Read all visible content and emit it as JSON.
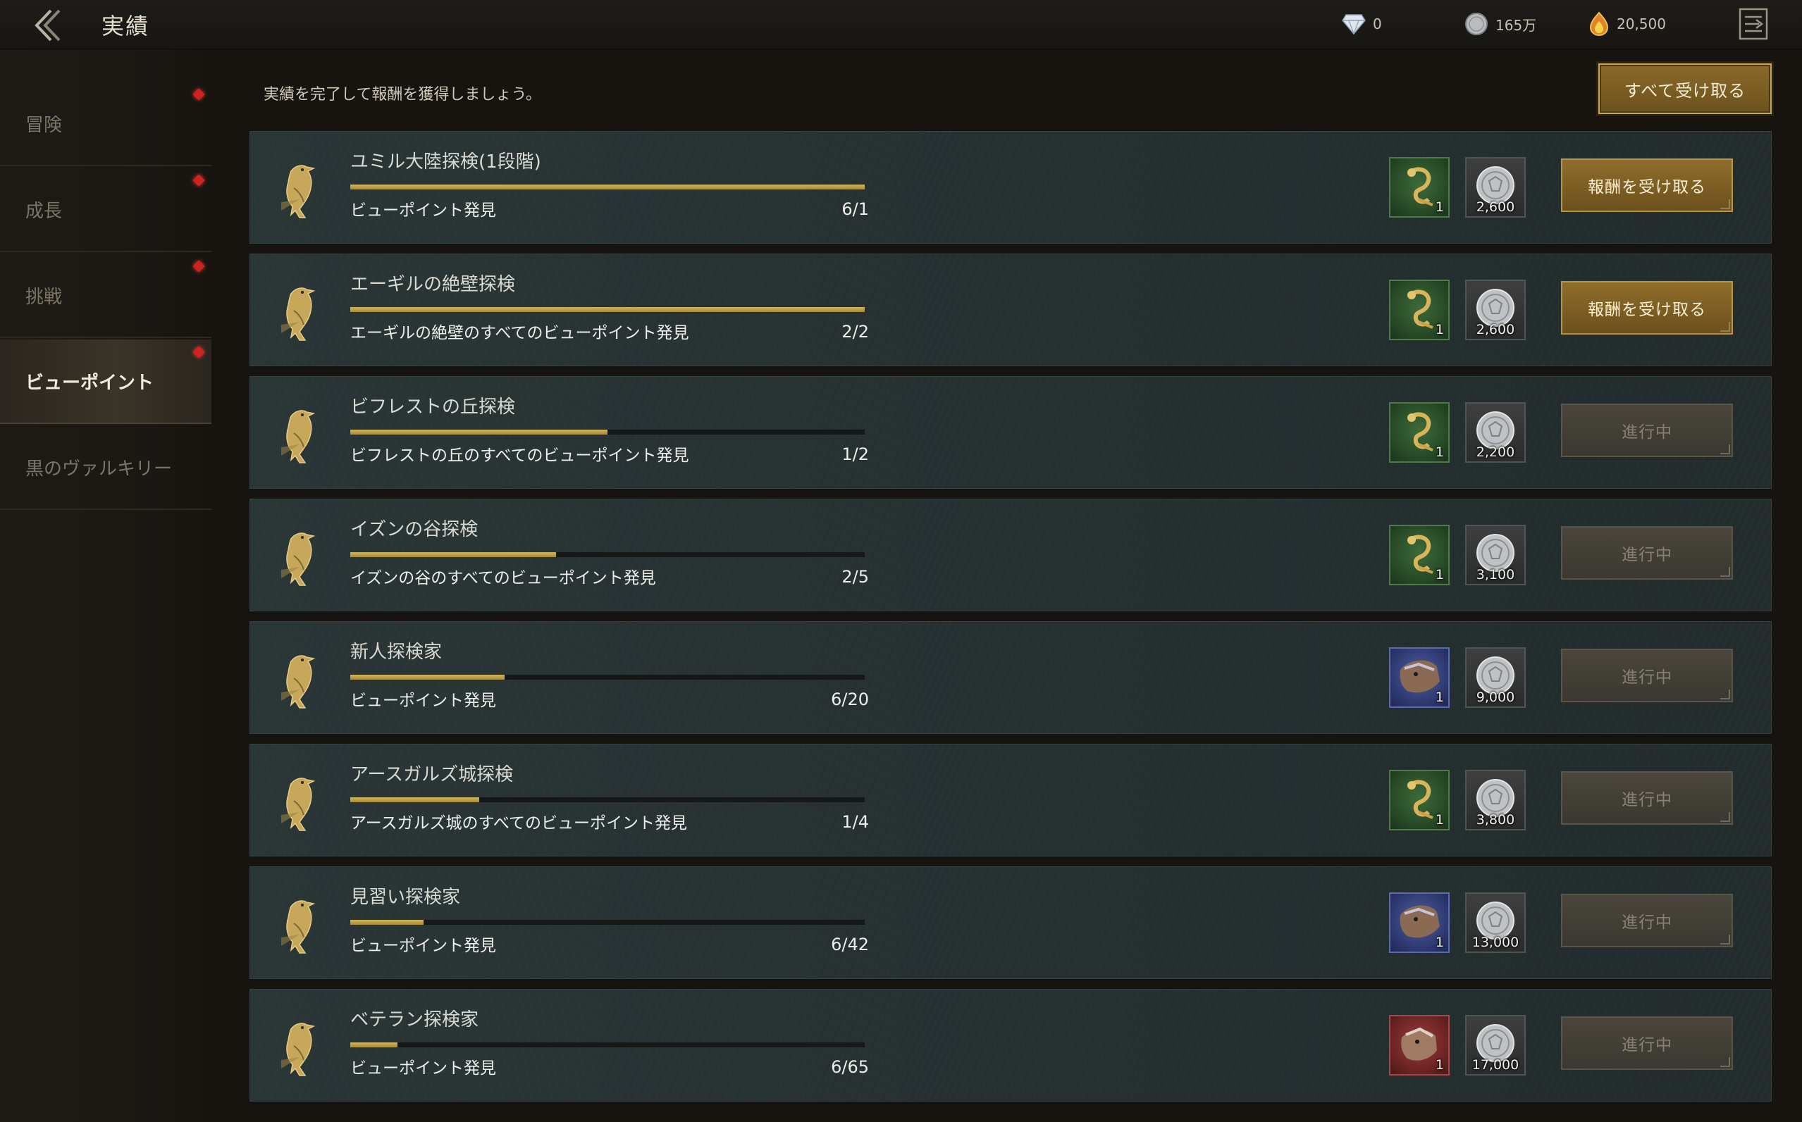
{
  "header": {
    "title": "実績",
    "currencies": [
      {
        "icon": "diamond-icon",
        "value": "0"
      },
      {
        "icon": "silver-coin-icon",
        "value": "165万"
      },
      {
        "icon": "flame-gem-icon",
        "value": "20,500"
      }
    ]
  },
  "sidebar": {
    "items": [
      {
        "label": "冒険",
        "has_alert": true
      },
      {
        "label": "成長",
        "has_alert": true
      },
      {
        "label": "挑戦",
        "has_alert": true
      },
      {
        "label": "ビューポイント",
        "has_alert": true,
        "active": true
      },
      {
        "label": "黒のヴァルキリー",
        "has_alert": false
      }
    ]
  },
  "main": {
    "instruction": "実績を完了して報酬を獲得しましょう。",
    "claim_all_label": "すべて受け取る",
    "achievements": [
      {
        "title": "ユミル大陸探検(1段階)",
        "desc": "ビューポイント発見",
        "count": "6/1",
        "progress": 1.0,
        "item_type": "green",
        "item_qty": "1",
        "coin_qty": "2,600",
        "button": "報酬を受け取る",
        "state": "claim"
      },
      {
        "title": "エーギルの絶壁探検",
        "desc": "エーギルの絶壁のすべてのビューポイント発見",
        "count": "2/2",
        "progress": 1.0,
        "item_type": "green",
        "item_qty": "1",
        "coin_qty": "2,600",
        "button": "報酬を受け取る",
        "state": "claim"
      },
      {
        "title": "ビフレストの丘探検",
        "desc": "ビフレストの丘のすべてのビューポイント発見",
        "count": "1/2",
        "progress": 0.5,
        "item_type": "green",
        "item_qty": "1",
        "coin_qty": "2,200",
        "button": "進行中",
        "state": "progress"
      },
      {
        "title": "イズンの谷探検",
        "desc": "イズンの谷のすべてのビューポイント発見",
        "count": "2/5",
        "progress": 0.4,
        "item_type": "green",
        "item_qty": "1",
        "coin_qty": "3,100",
        "button": "進行中",
        "state": "progress"
      },
      {
        "title": "新人探検家",
        "desc": "ビューポイント発見",
        "count": "6/20",
        "progress": 0.3,
        "item_type": "blue",
        "item_qty": "1",
        "coin_qty": "9,000",
        "button": "進行中",
        "state": "progress"
      },
      {
        "title": "アースガルズ城探検",
        "desc": "アースガルズ城のすべてのビューポイント発見",
        "count": "1/4",
        "progress": 0.25,
        "item_type": "green",
        "item_qty": "1",
        "coin_qty": "3,800",
        "button": "進行中",
        "state": "progress"
      },
      {
        "title": "見習い探検家",
        "desc": "ビューポイント発見",
        "count": "6/42",
        "progress": 0.143,
        "item_type": "blue",
        "item_qty": "1",
        "coin_qty": "13,000",
        "button": "進行中",
        "state": "progress"
      },
      {
        "title": "ベテラン探検家",
        "desc": "ビューポイント発見",
        "count": "6/65",
        "progress": 0.092,
        "item_type": "red",
        "item_qty": "1",
        "coin_qty": "17,000",
        "button": "進行中",
        "state": "progress"
      }
    ]
  }
}
